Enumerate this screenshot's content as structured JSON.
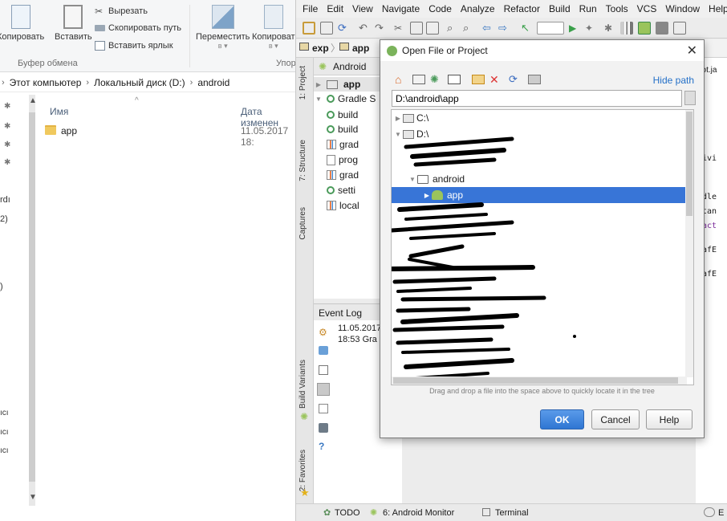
{
  "explorer": {
    "ribbon": {
      "cut": "Вырезать",
      "copy_path": "Скопировать путь",
      "paste_shortcut": "Вставить ярлык",
      "copy": "Копировать",
      "paste": "Вставить",
      "move": "Переместить",
      "move_sub": "в",
      "copy_to": "Копироват",
      "copy_to_sub": "в",
      "group_clipboard": "Буфер обмена",
      "group_organize": "Упор"
    },
    "address": {
      "chev": "›",
      "crumbs": [
        "Этот компьютер",
        "Локальный диск (D:)",
        "android"
      ]
    },
    "columns": {
      "name": "Имя",
      "date": "Дата изменен"
    },
    "files": [
      {
        "name": "app",
        "date": "11.05.2017 18:"
      }
    ],
    "nav_fragments": [
      "rdı",
      "2)",
      ")",
      "ıcı",
      "ıcı",
      "ıcı"
    ]
  },
  "ide": {
    "menu": [
      "File",
      "Edit",
      "View",
      "Navigate",
      "Code",
      "Analyze",
      "Refactor",
      "Build",
      "Run",
      "Tools",
      "VCS",
      "Window",
      "Help"
    ],
    "breadcrumb": [
      "exp",
      "app"
    ],
    "project_view": "Android",
    "tree": [
      {
        "label": "app"
      },
      {
        "label": "Gradle S"
      },
      {
        "label": "build"
      },
      {
        "label": "build"
      },
      {
        "label": "grad"
      },
      {
        "label": "prog"
      },
      {
        "label": "grad"
      },
      {
        "label": "setti"
      },
      {
        "label": "local"
      }
    ],
    "side_tabs": {
      "project": "1: Project",
      "structure": "7: Structure",
      "captures": "Captures",
      "build_variants": "Build Variants",
      "favorites": "2: Favorites"
    },
    "event_log": {
      "title": "Event Log",
      "date": "11.05.2017",
      "line": "18:53  Gra"
    },
    "code_fragments": [
      "bot.ja",
      "civi",
      "ndle",
      "etan",
      ".act",
      "rafE",
      "rafE"
    ],
    "status": {
      "todo": "TODO",
      "monitor": "6: Android Monitor",
      "terminal": "Terminal",
      "event": "E"
    }
  },
  "dialog": {
    "title": "Open File or Project",
    "hide_path": "Hide path",
    "path": "D:\\android\\app",
    "tree": [
      {
        "label": "C:\\",
        "expanded": false
      },
      {
        "label": "D:\\",
        "expanded": true
      },
      {
        "label": "android",
        "expanded": true
      },
      {
        "label": "app",
        "selected": true
      }
    ],
    "drag_hint": "Drag and drop a file into the space above to quickly locate it in the tree",
    "buttons": {
      "ok": "OK",
      "cancel": "Cancel",
      "help": "Help"
    }
  },
  "colors": {
    "selection": "#3875d7",
    "ok_button": "#2f76d3",
    "link": "#2470c8",
    "folder": "#f0c95e",
    "android_green": "#9ac45c"
  }
}
